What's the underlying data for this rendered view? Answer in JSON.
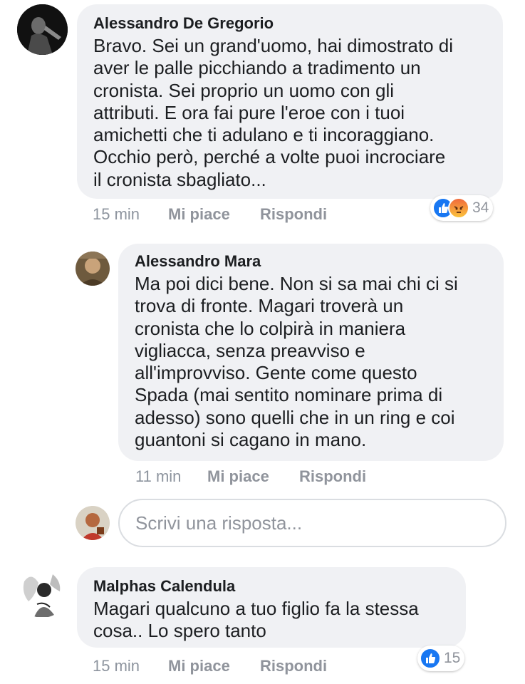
{
  "comments": [
    {
      "author": "Alessandro De Gregorio",
      "text": "Bravo. Sei un grand'uomo, hai dimostrato di\naver le palle picchiando a tradimento un\ncronista. Sei proprio un uomo con gli\nattributi. E ora fai pure l'eroe con i tuoi\namichetti che ti adulano e ti incoraggiano.\nOcchio però, perché a volte puoi incrociare\nil cronista sbagliato...",
      "time": "15 min",
      "like_label": "Mi piace",
      "reply_label": "Rispondi",
      "reaction_count": "34",
      "reactions": [
        "like-icon",
        "angry-icon"
      ]
    },
    {
      "author": "Alessandro Mara",
      "text": "Ma poi dici bene. Non si sa mai chi ci si\ntrova di fronte. Magari troverà un\ncronista che lo colpirà in maniera\nvigliacca, senza preavviso e\nall'improvviso. Gente come questo\nSpada (mai sentito nominare prima di\nadesso) sono quelli che in un ring e coi\nguantoni si cagano in mano.",
      "time": "11 min",
      "like_label": "Mi piace",
      "reply_label": "Rispondi"
    },
    {
      "author": "Malphas Calendula",
      "text": "Magari qualcuno a tuo figlio fa la stessa\ncosa.. Lo spero tanto",
      "time": "15 min",
      "like_label": "Mi piace",
      "reply_label": "Rispondi",
      "reaction_count": "15",
      "reactions": [
        "like-icon"
      ]
    }
  ],
  "reply_box": {
    "placeholder": "Scrivi una risposta..."
  },
  "colors": {
    "bubble": "#f0f1f4",
    "like_blue": "#1877f2",
    "angry_orange": "#f7714c",
    "meta_gray": "#90949c"
  }
}
